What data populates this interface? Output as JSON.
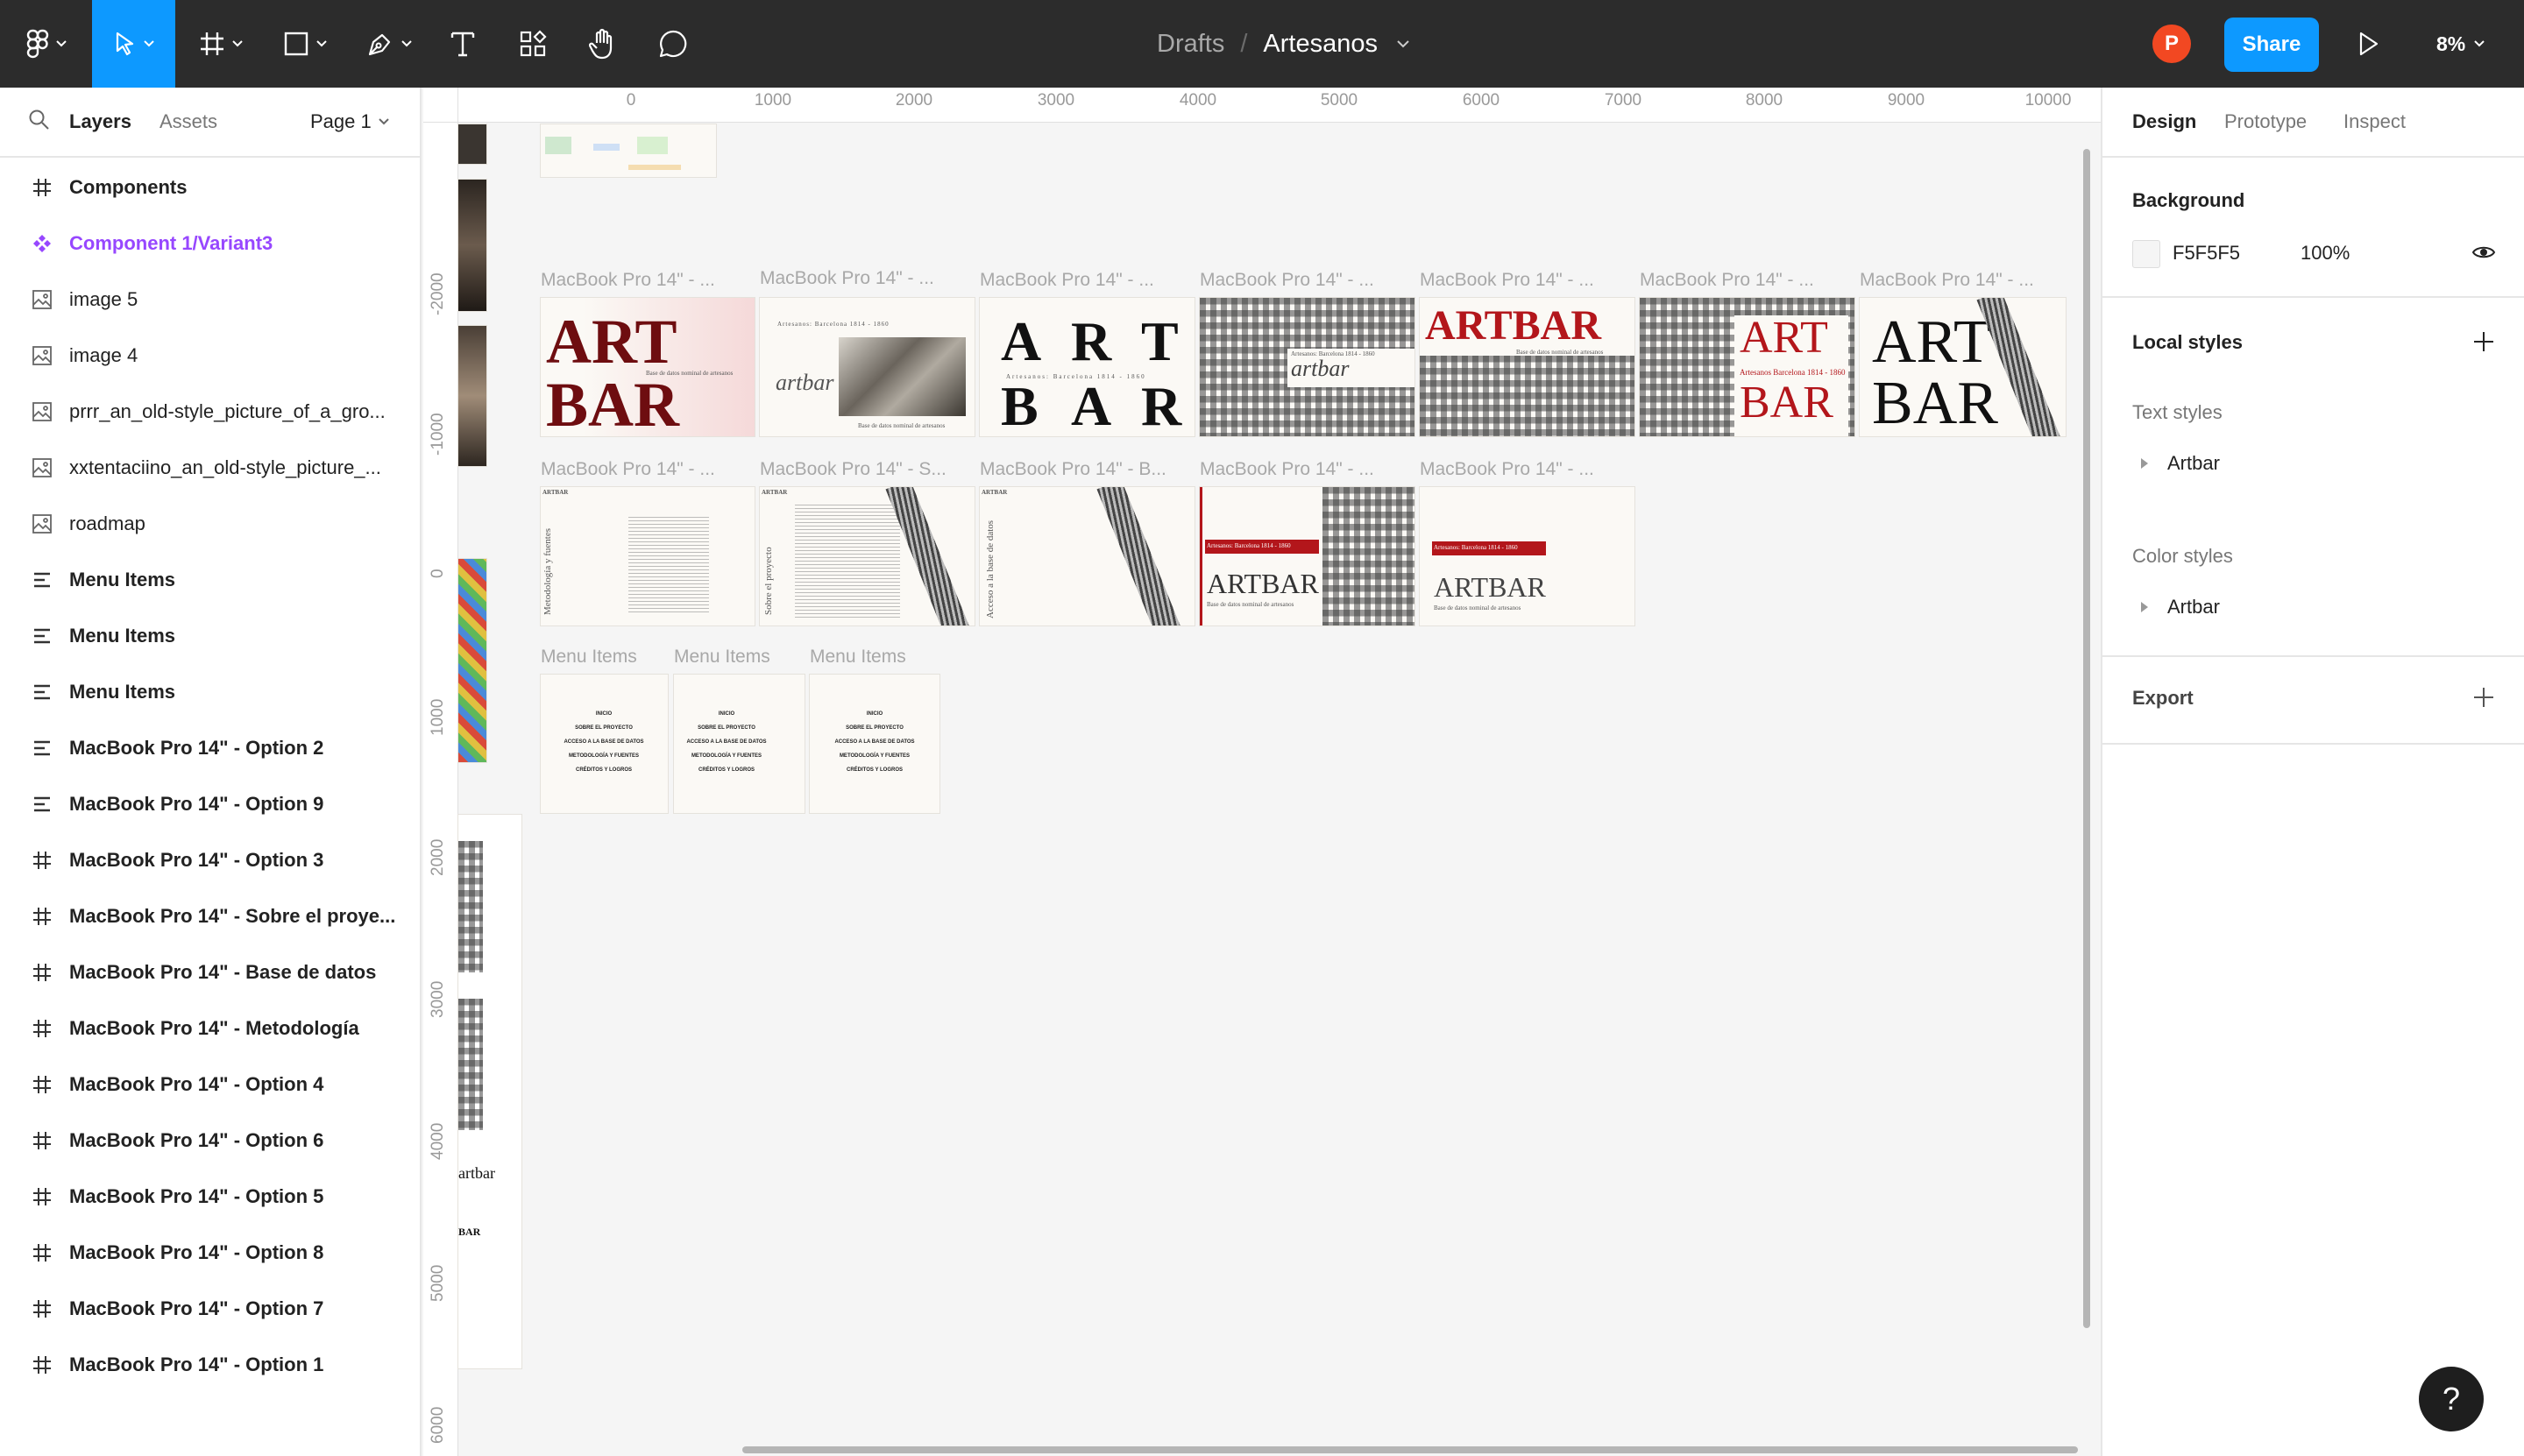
{
  "toolbar": {
    "breadcrumb_drafts": "Drafts",
    "breadcrumb_sep": "/",
    "file_name": "Artesanos",
    "avatar_initial": "P",
    "share_label": "Share",
    "zoom_label": "8%",
    "accent_color": "#0d99ff"
  },
  "left_panel": {
    "tab_layers": "Layers",
    "tab_assets": "Assets",
    "page_label": "Page 1",
    "layers": [
      {
        "name": "Components",
        "icon": "frame-icon"
      },
      {
        "name": "Component 1/Variant3",
        "icon": "component-icon"
      },
      {
        "name": "image 5",
        "icon": "image-icon"
      },
      {
        "name": "image 4",
        "icon": "image-icon"
      },
      {
        "name": "prrr_an_old-style_picture_of_a_gro...",
        "icon": "image-icon"
      },
      {
        "name": "xxtentaciino_an_old-style_picture_...",
        "icon": "image-icon"
      },
      {
        "name": "roadmap",
        "icon": "image-icon"
      },
      {
        "name": "Menu Items",
        "icon": "auto-layout-icon"
      },
      {
        "name": "Menu Items",
        "icon": "auto-layout-icon"
      },
      {
        "name": "Menu Items",
        "icon": "auto-layout-icon"
      },
      {
        "name": "MacBook Pro 14\" - Option 2",
        "icon": "auto-layout-icon"
      },
      {
        "name": "MacBook Pro 14\" - Option 9",
        "icon": "auto-layout-icon"
      },
      {
        "name": "MacBook Pro 14\" - Option 3",
        "icon": "frame-icon"
      },
      {
        "name": "MacBook Pro 14\" - Sobre el proye...",
        "icon": "frame-icon"
      },
      {
        "name": "MacBook Pro 14\" - Base de datos",
        "icon": "frame-icon"
      },
      {
        "name": "MacBook Pro 14\" - Metodología",
        "icon": "frame-icon"
      },
      {
        "name": "MacBook Pro 14\" - Option 4",
        "icon": "frame-icon"
      },
      {
        "name": "MacBook Pro 14\" - Option 6",
        "icon": "frame-icon"
      },
      {
        "name": "MacBook Pro 14\" - Option 5",
        "icon": "frame-icon"
      },
      {
        "name": "MacBook Pro 14\" - Option 8",
        "icon": "frame-icon"
      },
      {
        "name": "MacBook Pro 14\" - Option 7",
        "icon": "frame-icon"
      },
      {
        "name": "MacBook Pro 14\" - Option 1",
        "icon": "frame-icon"
      }
    ]
  },
  "canvas": {
    "ruler_top": [
      "0",
      "1000",
      "2000",
      "3000",
      "4000",
      "5000",
      "6000",
      "7000",
      "8000",
      "9000",
      "10000"
    ],
    "ruler_left": [
      "-2000",
      "-1000",
      "0",
      "1000",
      "2000",
      "3000",
      "4000",
      "5000",
      "6000"
    ],
    "row1_labels": [
      "MacBook Pro 14\" - ...",
      "MacBook Pro 14\" - ...",
      "MacBook Pro 14\" - ...",
      "MacBook Pro 14\" - ...",
      "MacBook Pro 14\" - ...",
      "MacBook Pro 14\" - ...",
      "MacBook Pro 14\" - ..."
    ],
    "row2_labels": [
      "MacBook Pro 14\" - ...",
      "MacBook Pro 14\" - S...",
      "MacBook Pro 14\" - B...",
      "MacBook Pro 14\" - ...",
      "MacBook Pro 14\" - ..."
    ],
    "row3_labels": [
      "Menu Items",
      "Menu Items",
      "Menu Items"
    ],
    "art": "ART",
    "bar": "BAR",
    "artbar": "ARTBAR",
    "artbar_script": "artbar",
    "a_letter": "A",
    "r_letter": "R",
    "t_letter": "T",
    "b_letter": "B",
    "subtitle": "Base de datos nominal de artesanos",
    "place_dates": "Artesanos: Barcelona 1814 - 1860",
    "place_dates_compact": "Artesanos Barcelona 1814 - 1860",
    "side_metodologia": "Metodología y fuentes",
    "side_sobre": "Sobre el proyecto",
    "side_acceso": "Acceso a la base de datos",
    "menu": [
      "INICIO",
      "SOBRE EL PROYECTO",
      "ACCESO A LA BASE DE DATOS",
      "METODOLOGÍA Y FUENTES",
      "CRÉDITOS Y LOGROS"
    ]
  },
  "right_panel": {
    "tab_design": "Design",
    "tab_prototype": "Prototype",
    "tab_inspect": "Inspect",
    "background_title": "Background",
    "background_hex": "F5F5F5",
    "background_opacity": "100%",
    "local_styles_title": "Local styles",
    "text_styles_label": "Text styles",
    "text_style_item": "Artbar",
    "color_styles_label": "Color styles",
    "color_style_item": "Artbar",
    "export_title": "Export"
  },
  "help_label": "?"
}
